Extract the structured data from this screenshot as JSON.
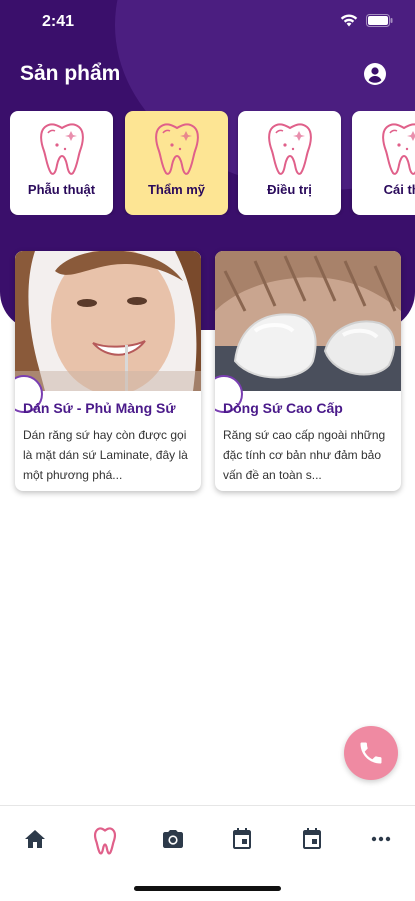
{
  "status_bar": {
    "time": "2:41",
    "icons": [
      "wifi-icon",
      "battery-icon"
    ]
  },
  "header": {
    "title": "Sản phẩm",
    "profile_icon": "account-circle-icon"
  },
  "categories": [
    {
      "label": "Phẫu thuật",
      "icon": "tooth-icon",
      "selected": false
    },
    {
      "label": "Thẩm mỹ",
      "icon": "tooth-icon",
      "selected": true
    },
    {
      "label": "Điều trị",
      "icon": "tooth-icon",
      "selected": false
    },
    {
      "label": "Cái thi",
      "icon": "tooth-icon",
      "selected": false
    }
  ],
  "products": [
    {
      "title": "Dán Sứ - Phủ Màng Sứ",
      "description": "Dán răng sứ hay còn được gọi là mặt dán sứ Laminate, đây là một phương phá..."
    },
    {
      "title": "Dòng Sứ Cao Cấp",
      "description": "Răng sứ cao cấp ngoài những đặc tính cơ bản như đảm bảo vấn đề an toàn s..."
    }
  ],
  "fab": {
    "icon": "phone-icon"
  },
  "bottom_nav": {
    "items": [
      {
        "icon": "home-icon"
      },
      {
        "icon": "tooth-icon",
        "active": true
      },
      {
        "icon": "camera-icon"
      },
      {
        "icon": "calendar-icon"
      },
      {
        "icon": "calendar-icon"
      },
      {
        "icon": "more-icon"
      }
    ]
  },
  "colors": {
    "header_bg": "#3a0f6b",
    "selected_category": "#fde594",
    "accent_pink": "#ef8aa2",
    "title_purple": "#4a1a8a"
  }
}
